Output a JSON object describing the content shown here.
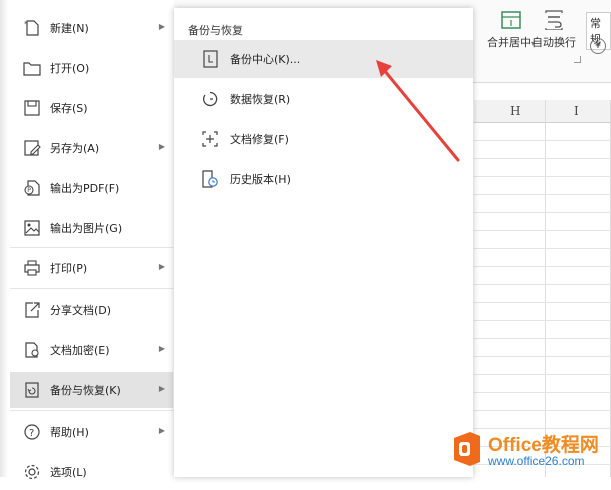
{
  "ribbon": {
    "merge_center": "合并居中",
    "merge_arrow": "▾",
    "wrap_text": "自动换行",
    "format_label": "常规",
    "currency_symbol": "¥"
  },
  "sheet": {
    "columns": [
      "H",
      "I"
    ]
  },
  "left_menu": {
    "items": [
      {
        "label": "新建(N)",
        "icon": "new-file-icon",
        "has_submenu": true
      },
      {
        "label": "打开(O)",
        "icon": "folder-open-icon",
        "has_submenu": false
      },
      {
        "label": "保存(S)",
        "icon": "save-icon",
        "has_submenu": false
      },
      {
        "label": "另存为(A)",
        "icon": "save-as-icon",
        "has_submenu": true
      },
      {
        "label": "输出为PDF(F)",
        "icon": "export-pdf-icon",
        "has_submenu": false
      },
      {
        "label": "输出为图片(G)",
        "icon": "export-image-icon",
        "has_submenu": false
      },
      {
        "label": "打印(P)",
        "icon": "printer-icon",
        "has_submenu": true
      },
      {
        "label": "分享文档(D)",
        "icon": "share-icon",
        "has_submenu": false
      },
      {
        "label": "文档加密(E)",
        "icon": "encrypt-icon",
        "has_submenu": true
      },
      {
        "label": "备份与恢复(K)",
        "icon": "backup-restore-icon",
        "has_submenu": true,
        "active": true
      },
      {
        "label": "帮助(H)",
        "icon": "help-icon",
        "has_submenu": true
      },
      {
        "label": "选项(L)",
        "icon": "gear-icon",
        "has_submenu": false
      }
    ]
  },
  "submenu": {
    "title": "备份与恢复",
    "items": [
      {
        "label": "备份中心(K)...",
        "icon": "backup-center-icon",
        "active": true
      },
      {
        "label": "数据恢复(R)",
        "icon": "data-recovery-icon"
      },
      {
        "label": "文档修复(F)",
        "icon": "document-repair-icon"
      },
      {
        "label": "历史版本(H)",
        "icon": "history-version-icon"
      }
    ]
  },
  "annotation": {
    "arrow_color": "#e8413c"
  },
  "watermark": {
    "line1": "Office教程网",
    "line2": "www.office26.com",
    "logo_color": "#ef6a1a"
  },
  "colors": {
    "accent": "#2a7fd4"
  }
}
